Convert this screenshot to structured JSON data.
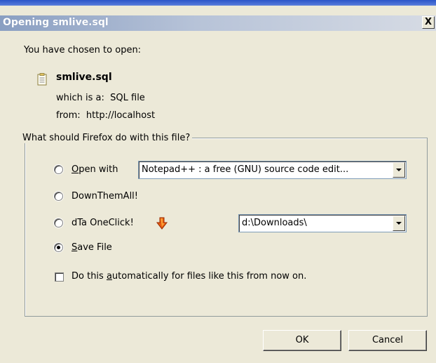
{
  "window": {
    "title": "Opening smlive.sql",
    "close_glyph": "X"
  },
  "intro": {
    "prompt": "You have chosen to open:",
    "file_name": "smlive.sql",
    "which_is_label": "which is a:",
    "file_type": "SQL file",
    "from_label": "from:",
    "source_url": "http://localhost"
  },
  "options": {
    "group_label": "What should Firefox do with this file?",
    "open_with": {
      "accesskey": "O",
      "rest": "pen with",
      "app_value": "Notepad++ : a free (GNU) source code edit..."
    },
    "downthemall_label": "DownThemAll!",
    "dta_oneclick": {
      "label": "dTa OneClick!",
      "folder_value": "d:\\Downloads\\"
    },
    "save_file": {
      "accesskey": "S",
      "rest": "ave File"
    },
    "selected": "save_file",
    "auto": {
      "pre": "Do this ",
      "accesskey": "a",
      "post": "utomatically for files like this from now on.",
      "checked": false
    }
  },
  "buttons": {
    "ok_label": "OK",
    "cancel_label": "Cancel"
  },
  "colors": {
    "dialog_bg": "#ece9d8",
    "title_band_start": "#8a9fc2",
    "accent_blue": "#2a55c8"
  }
}
